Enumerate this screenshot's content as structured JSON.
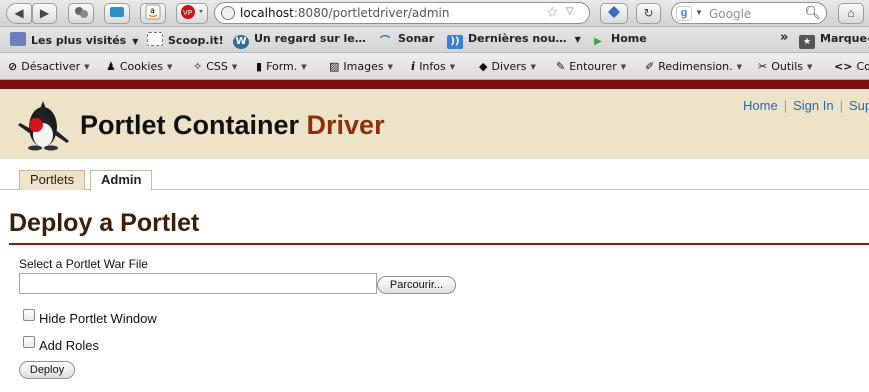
{
  "browser": {
    "url_host": "localhost",
    "url_rest": ":8080/portletdriver/admin",
    "search_placeholder": "Google",
    "back_icon": "◀",
    "forward_icon": "▶",
    "reload_icon": "↻",
    "home_icon": "⌂"
  },
  "bookmarks": [
    {
      "label": "Les plus visités",
      "icon": "bookmark-folder-icon",
      "dropdown": true
    },
    {
      "label": "Scoop.it!",
      "icon": "page-icon",
      "dropdown": false
    },
    {
      "label": "Un regard sur le…",
      "icon": "wordpress-icon",
      "dropdown": false
    },
    {
      "label": "Sonar",
      "icon": "sonar-icon",
      "dropdown": false
    },
    {
      "label": "Dernières nou…",
      "icon": "rss-icon",
      "dropdown": true
    },
    {
      "label": "Home",
      "icon": "play-icon",
      "dropdown": false
    }
  ],
  "bookmarks_overflow": "»",
  "bookmarks_more": "Marque-",
  "devtools": [
    {
      "label": "Désactiver"
    },
    {
      "label": "Cookies"
    },
    {
      "label": "CSS"
    },
    {
      "label": "Form."
    },
    {
      "label": "Images"
    },
    {
      "label": "Infos"
    },
    {
      "label": "Divers"
    },
    {
      "label": "Entourer"
    },
    {
      "label": "Redimension."
    },
    {
      "label": "Outils"
    },
    {
      "label": "Co"
    }
  ],
  "header": {
    "title_main": "Portlet Container ",
    "title_accent": "Driver",
    "links": [
      "Home",
      "Sign In",
      "Sup"
    ]
  },
  "tabs": [
    {
      "label": "Portlets",
      "active": false
    },
    {
      "label": "Admin",
      "active": true
    }
  ],
  "main": {
    "heading": "Deploy a Portlet",
    "file_label": "Select a Portlet War File",
    "file_value": "",
    "browse_label": "Parcourir...",
    "hide_window_label": "Hide Portlet Window",
    "hide_window_checked": false,
    "add_roles_label": "Add Roles",
    "add_roles_checked": false,
    "deploy_label": "Deploy"
  },
  "colors": {
    "header_bg": "#ece3c9",
    "brand_red": "#7a0f12",
    "accent_text": "#8c2f0c",
    "link": "#2a6aa8"
  }
}
